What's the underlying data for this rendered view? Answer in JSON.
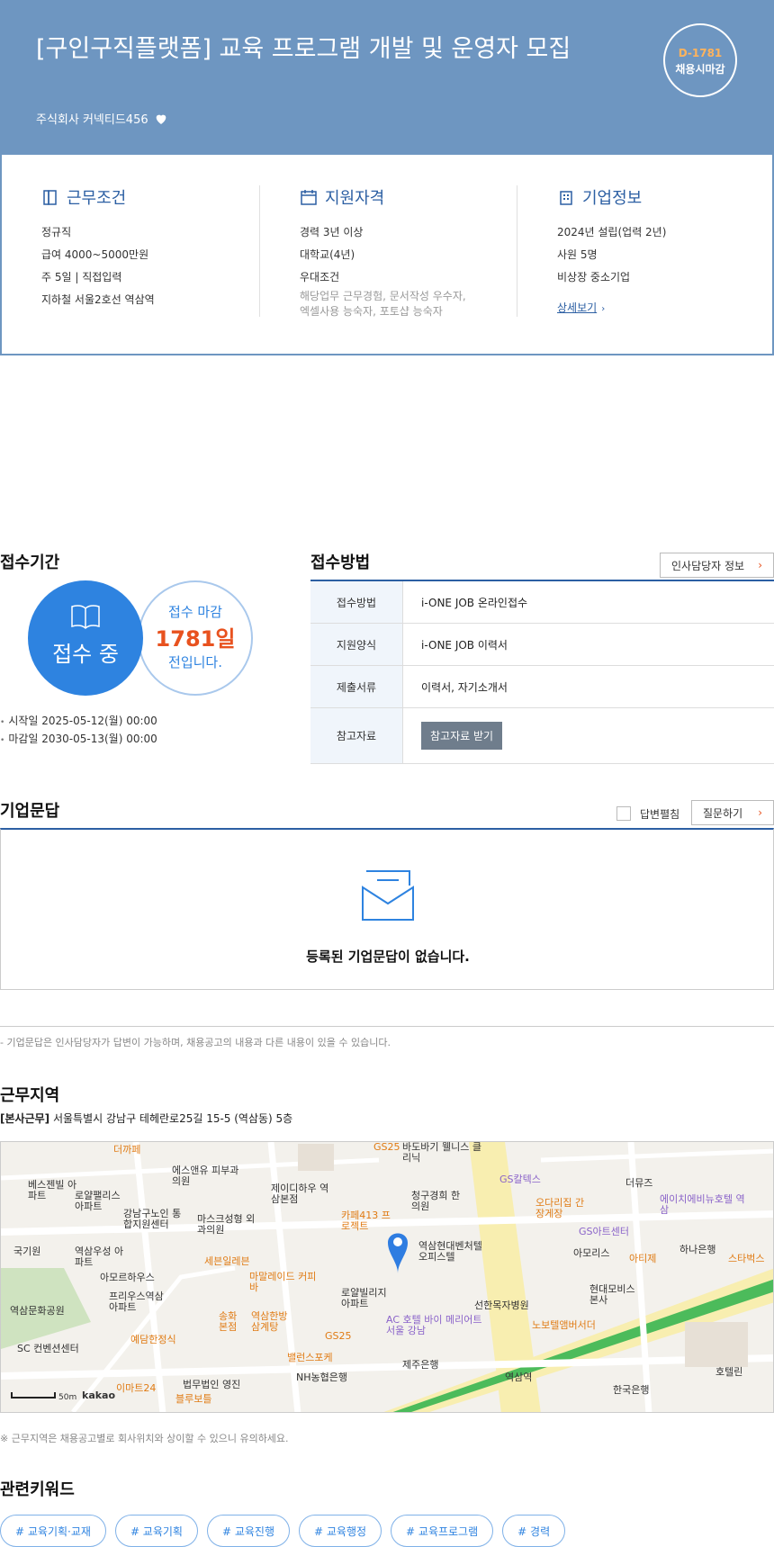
{
  "header": {
    "title": "[구인구직플랫폼] 교육 프로그램 개발 및 운영자 모집",
    "company": "주식회사 커넥티드456",
    "dday": "D-1781",
    "dday_sub": "채용시마감"
  },
  "conditions": {
    "title": "근무조건",
    "items": [
      "정규직",
      "급여 4000~5000만원",
      "주 5일 | 직접입력",
      "지하철 서울2호선 역삼역"
    ]
  },
  "qualifications": {
    "title": "지원자격",
    "items": [
      "경력 3년 이상",
      "대학교(4년)",
      "우대조건"
    ],
    "preferred": "해당업무 근무경험, 문서작성 우수자,",
    "preferred2": "엑셀사용 능숙자, 포토샵 능숙자"
  },
  "company_info": {
    "title": "기업정보",
    "items": [
      "2024년 설립(업력 2년)",
      "사원 5명",
      "비상장 중소기업"
    ],
    "detail_link": "상세보기"
  },
  "period": {
    "title": "접수기간",
    "status": "접수 중",
    "deadline_label": "접수 마감",
    "days": "1781일",
    "suffix": "전입니다.",
    "start": "시작일 2025-05-12(월) 00:00",
    "end": "마감일 2030-05-13(월) 00:00"
  },
  "method": {
    "title": "접수방법",
    "hr_button": "인사담당자 정보",
    "rows": [
      {
        "k": "접수방법",
        "v": "i-ONE JOB 온라인접수"
      },
      {
        "k": "지원양식",
        "v": "i-ONE JOB 이력서"
      },
      {
        "k": "제출서류",
        "v": "이력서, 자기소개서"
      },
      {
        "k": "참고자료",
        "v": "참고자료 받기"
      }
    ]
  },
  "qna": {
    "title": "기업문답",
    "fold_label": "답변펼침",
    "ask_button": "질문하기",
    "empty": "등록된 기업문답이 없습니다.",
    "note": "- 기업문답은 인사담당자가 답변이 가능하며, 채용공고의 내용과 다른 내용이 있을 수 있습니다."
  },
  "location": {
    "title": "근무지역",
    "tag": "[본사근무]",
    "address": "서울특별시 강남구 테헤란로25길 15-5 (역삼동) 5층",
    "note": "※ 근무지역은 채용공고별로 회사위치와 상이할 수 있으니 유의하세요.",
    "scale": "50m",
    "brand": "kakao",
    "labels": [
      "더까페",
      "에스앤유 피부과의원",
      "베스젠빌 아파트",
      "로얄팰리스 아파트",
      "강남구노인 통합지원센터",
      "마스크성형 외과의원",
      "제이디하우 역삼본점",
      "카페413 프로젝트",
      "청구경희 한의원",
      "GS칼텍스",
      "오다리집 간장게장",
      "더뮤즈",
      "에이치에비뉴호텔 역삼",
      "GS아트센터",
      "아모리스",
      "하나은행",
      "스타벅스",
      "아티제",
      "국기원",
      "역삼우성 아파트",
      "아모르하우스",
      "세븐일레븐",
      "마말레이드 커피바",
      "역삼현대벤처텔 오피스텔",
      "로얄빌리지 아파트",
      "선한목자병원",
      "현대모비스 본사",
      "프리우스역삼 아파트",
      "역삼문화공원",
      "송화 본점",
      "역삼한방 삼계탕",
      "AC 호텔 바이 메리어트 서울 강남",
      "GS25",
      "예담한정식",
      "밸런스포케",
      "SC 컨벤션센터",
      "이마트24",
      "법무법인 영진",
      "블루보틀",
      "NH농협은행",
      "제주은행",
      "역삼역",
      "한국은행",
      "호텔린",
      "노보텔앰버서더",
      "바도바기 웰니스 클리닉",
      "GS25"
    ]
  },
  "keywords": {
    "title": "관련키워드",
    "items": [
      "# 교육기획·교재",
      "# 교육기획",
      "# 교육진행",
      "# 교육행정",
      "# 교육프로그램",
      "# 경력"
    ]
  }
}
